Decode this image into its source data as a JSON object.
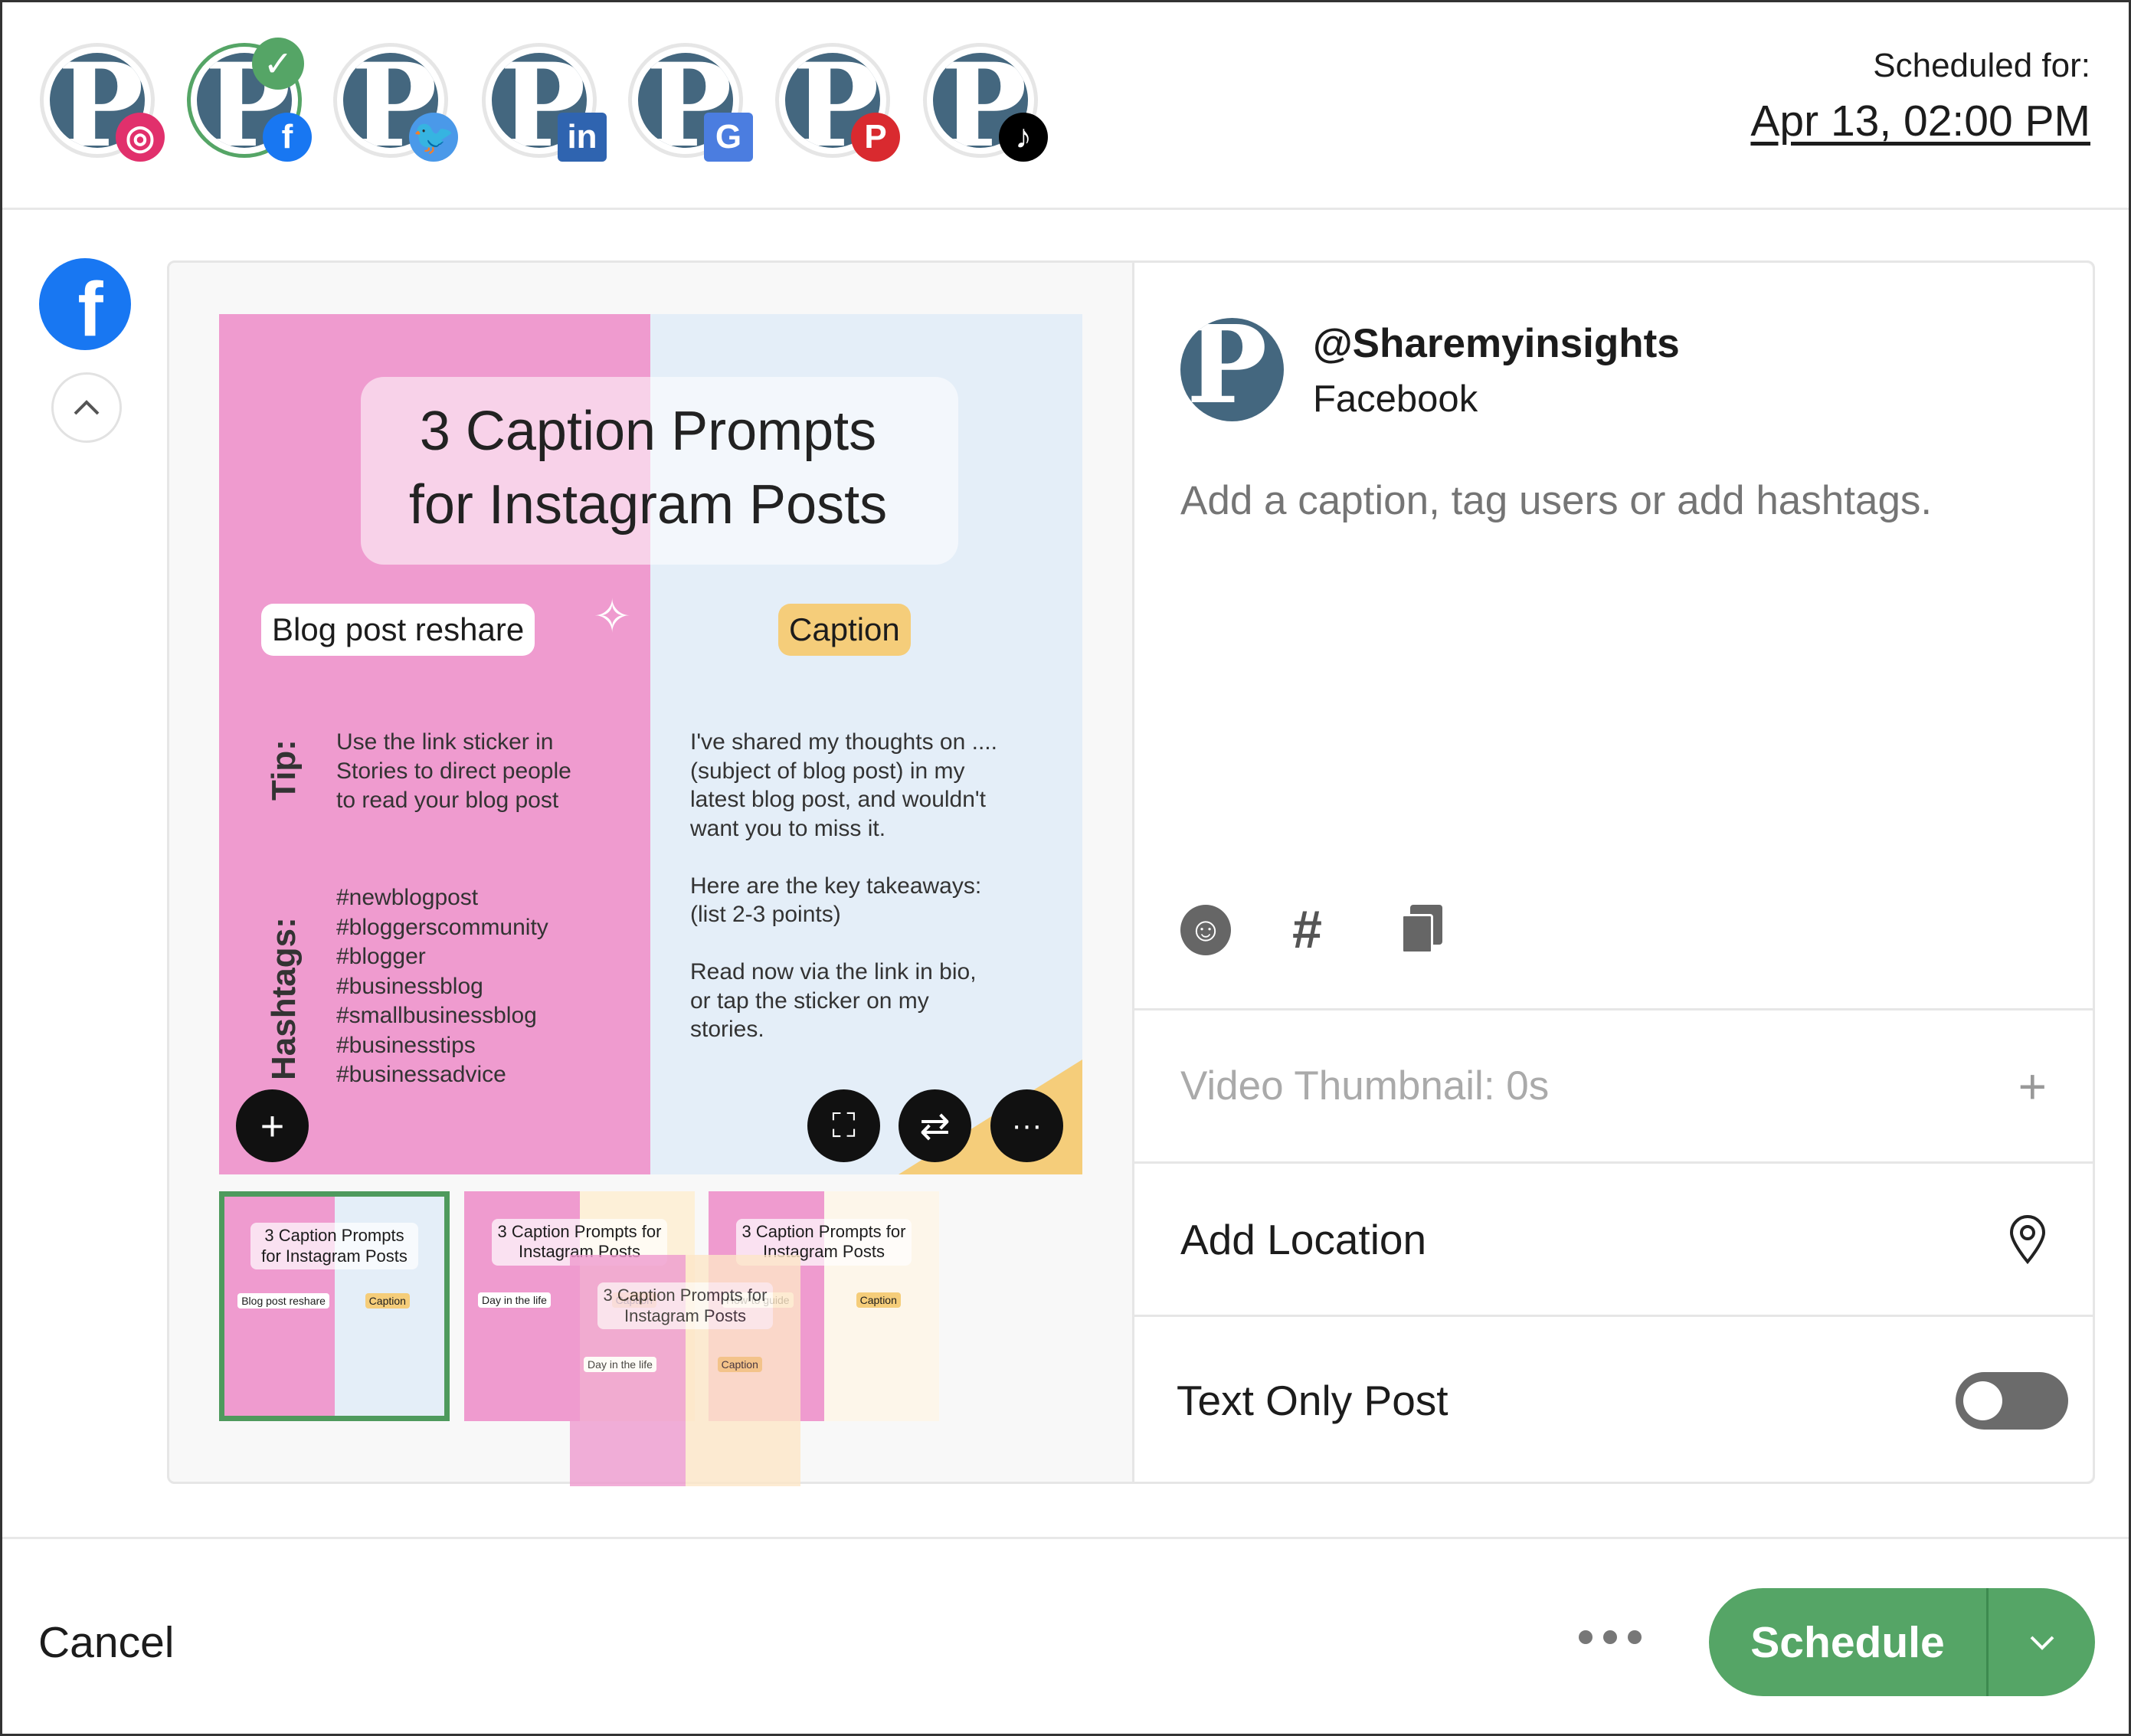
{
  "header": {
    "accounts": [
      {
        "network": "instagram",
        "icon": "instagram-icon",
        "color": "#e1306c",
        "selected": false
      },
      {
        "network": "facebook",
        "icon": "facebook-icon",
        "color": "#1877f2",
        "selected": true
      },
      {
        "network": "twitter",
        "icon": "twitter-icon",
        "color": "#4a99e9",
        "selected": false
      },
      {
        "network": "linkedin",
        "icon": "linkedin-icon",
        "color": "#2f64b0",
        "selected": false
      },
      {
        "network": "google-business",
        "icon": "google-business-icon",
        "color": "#4b7de0",
        "selected": false
      },
      {
        "network": "pinterest",
        "icon": "pinterest-icon",
        "color": "#d92a2f",
        "selected": false
      },
      {
        "network": "tiktok",
        "icon": "tiktok-icon",
        "color": "#000000",
        "selected": false
      }
    ],
    "scheduled_label": "Scheduled for:",
    "scheduled_date": "Apr 13, 02:00 PM"
  },
  "post_image": {
    "title_line1": "3 Caption Prompts",
    "title_line2": "for Instagram Posts",
    "left_label": "Blog post reshare",
    "right_label": "Caption",
    "tip_label": "Tip:",
    "tip_text": [
      "Use the link sticker in",
      "Stories to direct people",
      "to read your blog post"
    ],
    "hashtags_label": "Hashtags:",
    "hashtags": [
      "#newblogpost",
      "#bloggerscommunity",
      "#blogger",
      "#businessblog",
      "#smallbusinessblog",
      "#businesstips",
      "#businessadvice"
    ],
    "caption_text": [
      "I've shared my thoughts on ....",
      "(subject of blog post) in my",
      "latest blog post, and wouldn't",
      "want you to miss it.",
      "",
      "Here are the key takeaways:",
      "(list 2-3 points)",
      "",
      "Read now via the link in bio,",
      "or tap the sticker on my",
      "stories."
    ]
  },
  "thumbnails": [
    {
      "title": "3 Caption Prompts for Instagram Posts",
      "label": "Blog post reshare",
      "caption": "Caption",
      "selected": true,
      "right_color": "#e4eef8"
    },
    {
      "title": "3 Caption Prompts for Instagram Posts",
      "label": "Day in the life",
      "caption": "Caption",
      "selected": false,
      "right_color": "#fdf0d8"
    },
    {
      "title": "3 Caption Prompts for Instagram Posts",
      "label": "How-to guide",
      "caption": "Caption",
      "selected": false,
      "right_color": "#fdf6ea"
    },
    {
      "title": "3 Caption Prompts for Instagram Posts",
      "label": "Day in the life",
      "caption": "Caption",
      "selected": false,
      "right_color": "#fde7c8"
    }
  ],
  "composer": {
    "handle": "@Sharemyinsights",
    "network": "Facebook",
    "caption_placeholder": "Add a caption, tag users or add hashtags.",
    "video_thumbnail": "Video Thumbnail: 0s",
    "add_location": "Add Location",
    "text_only": "Text Only Post",
    "text_only_on": false
  },
  "footer": {
    "cancel": "Cancel",
    "schedule": "Schedule",
    "accent": "#55a566"
  }
}
